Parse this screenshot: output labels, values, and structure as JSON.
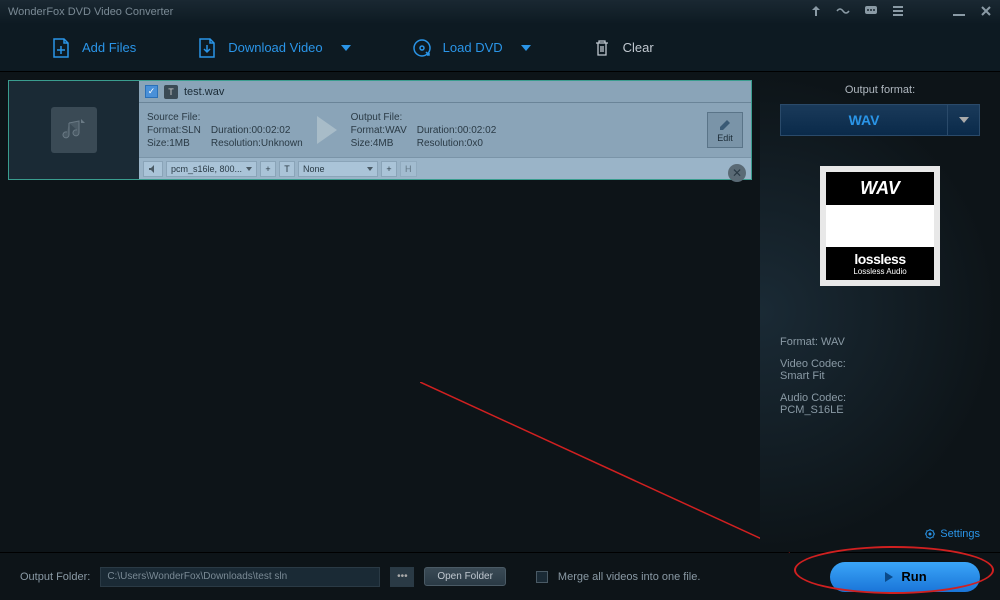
{
  "app": {
    "title": "WonderFox DVD Video Converter"
  },
  "toolbar": {
    "addFiles": "Add Files",
    "downloadVideo": "Download Video",
    "loadDVD": "Load DVD",
    "clear": "Clear"
  },
  "file": {
    "name": "test.wav",
    "source": {
      "label": "Source File:",
      "format": "Format:SLN",
      "size": "Size:1MB",
      "duration": "Duration:00:02:02",
      "resolution": "Resolution:Unknown"
    },
    "output": {
      "label": "Output File:",
      "format": "Format:WAV",
      "size": "Size:4MB",
      "duration": "Duration:00:02:02",
      "resolution": "Resolution:0x0"
    },
    "editLabel": "Edit",
    "audioTrack": "pcm_s16le, 800...",
    "subtitleTrack": "None"
  },
  "right": {
    "outputFormatLabel": "Output format:",
    "selectedFormat": "WAV",
    "card": {
      "big": "WAV",
      "logo": "lossless",
      "sub": "Lossless Audio"
    },
    "info": {
      "formatLabel": "Format:",
      "formatValue": "WAV",
      "videoCodecLabel": "Video Codec:",
      "videoCodecValue": "Smart Fit",
      "audioCodecLabel": "Audio Codec:",
      "audioCodecValue": "PCM_S16LE"
    },
    "settings": "Settings"
  },
  "bottom": {
    "outputFolderLabel": "Output Folder:",
    "outputFolderPath": "C:\\Users\\WonderFox\\Downloads\\test sln",
    "openFolder": "Open Folder",
    "mergeLabel": "Merge all videos into one file.",
    "run": "Run"
  }
}
